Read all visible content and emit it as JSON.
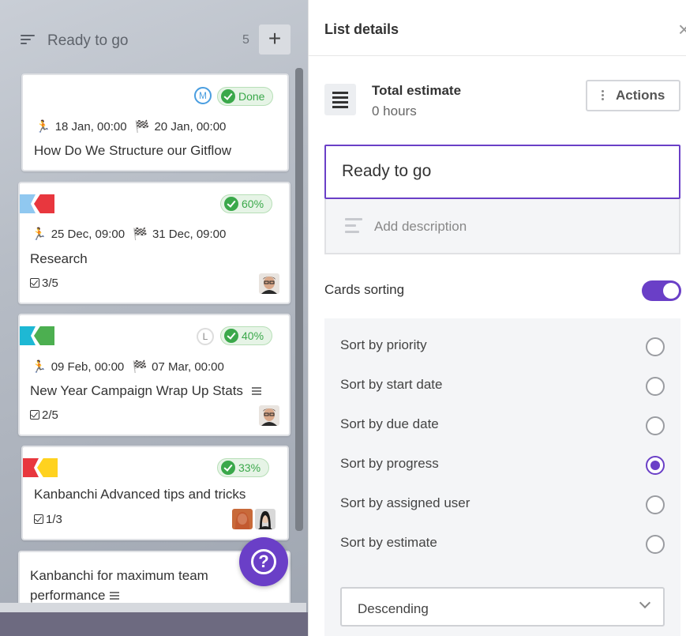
{
  "board": {
    "list_title": "Ready to go",
    "card_count": "5",
    "add_label": "+",
    "help_label": "?",
    "cards": [
      {
        "title": "How Do We Structure our Gitflow",
        "start": "18 Jan, 00:00",
        "due": "20 Jan, 00:00",
        "status": "Done",
        "ring": "M",
        "tasks": ""
      },
      {
        "title": "Research",
        "start": "25 Dec, 09:00",
        "due": "31 Dec, 09:00",
        "status": "60%",
        "tasks": "3/5",
        "tags": [
          "#90c8f0",
          "#e8373e"
        ]
      },
      {
        "title": "New Year Campaign Wrap Up Stats",
        "start": "09 Feb, 00:00",
        "due": "07 Mar, 00:00",
        "status": "40%",
        "ring": "L",
        "tasks": "2/5",
        "tags": [
          "#1eb8d4",
          "#4caf50"
        ]
      },
      {
        "title": "Kanbanchi Advanced tips and tricks",
        "status": "33%",
        "tasks": "1/3",
        "tags": [
          "#e8373e",
          "#ffd21f"
        ]
      },
      {
        "title_line1": "Kanbanchi for maximum team",
        "title_line2": "performance"
      }
    ]
  },
  "panel": {
    "title": "List details",
    "close_label": "×",
    "estimate_label": "Total estimate",
    "estimate_value": "0 hours",
    "actions_label": "Actions",
    "list_name_value": "Ready to go",
    "description_placeholder": "Add description",
    "cards_sorting_label": "Cards sorting",
    "cards_sorting_enabled": true,
    "sort_options": [
      {
        "label": "Sort by priority",
        "selected": false
      },
      {
        "label": "Sort by start date",
        "selected": false
      },
      {
        "label": "Sort by due date",
        "selected": false
      },
      {
        "label": "Sort by progress",
        "selected": true
      },
      {
        "label": "Sort by assigned user",
        "selected": false
      },
      {
        "label": "Sort by estimate",
        "selected": false
      }
    ],
    "order_value": "Descending"
  },
  "colors": {
    "accent": "#6a3fc7",
    "done_green": "#3aa84a"
  }
}
